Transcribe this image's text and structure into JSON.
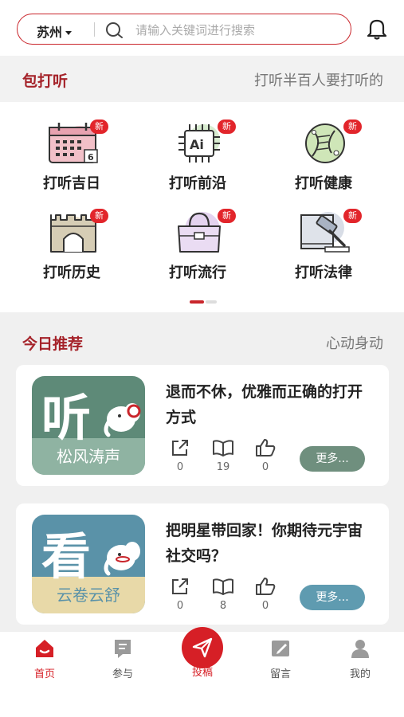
{
  "search": {
    "city": "苏州",
    "placeholder": "请输入关键词进行搜索"
  },
  "section1": {
    "title": "包打听",
    "subtitle": "打听半百人要打听的",
    "items": [
      {
        "label": "打听吉日",
        "badge": "新",
        "icon": "calendar-icon"
      },
      {
        "label": "打听前沿",
        "badge": "新",
        "icon": "ai-chip-icon"
      },
      {
        "label": "打听健康",
        "badge": "新",
        "icon": "dna-icon"
      },
      {
        "label": "打听历史",
        "badge": "新",
        "icon": "city-gate-icon"
      },
      {
        "label": "打听流行",
        "badge": "新",
        "icon": "handbag-icon"
      },
      {
        "label": "打听法律",
        "badge": "新",
        "icon": "gavel-icon"
      }
    ]
  },
  "section2": {
    "title": "今日推荐",
    "subtitle": "心动身动",
    "cards": [
      {
        "thumb_char": "听",
        "thumb_text": "松风涛声",
        "title": "退而不休，优雅而正确的打开方式",
        "shares": "0",
        "reads": "19",
        "likes": "0",
        "more": "更多..."
      },
      {
        "thumb_char": "看",
        "thumb_text": "云卷云舒",
        "title": "把明星带回家！你期待元宇宙社交吗？",
        "shares": "0",
        "reads": "8",
        "likes": "0",
        "more": "更多..."
      }
    ]
  },
  "nav": [
    {
      "label": "首页"
    },
    {
      "label": "参与"
    },
    {
      "label": "投稿"
    },
    {
      "label": "留言"
    },
    {
      "label": "我的"
    }
  ],
  "colors": {
    "accent": "#c9252b",
    "card1": "#5e8a78",
    "card2": "#5a92a8"
  }
}
